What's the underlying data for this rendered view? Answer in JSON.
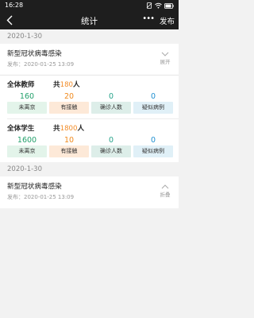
{
  "status": {
    "time": "16:28"
  },
  "nav": {
    "title": "统计",
    "more": "•••",
    "publish": "发布"
  },
  "sections": [
    {
      "date": "2020-1-30",
      "title": "新型冠状病毒感染",
      "meta": "发布：2020-01-25  13:09",
      "toggle_label": "展开",
      "groups": [
        {
          "label": "全体教师",
          "total_prefix": "共",
          "total": "180",
          "total_suffix": "人",
          "stats": [
            {
              "value": "160",
              "label": "未离京"
            },
            {
              "value": "20",
              "label": "有接触"
            },
            {
              "value": "0",
              "label": "确诊人数"
            },
            {
              "value": "0",
              "label": "疑似病例"
            }
          ]
        },
        {
          "label": "全体学生",
          "total_prefix": "共",
          "total": "1800",
          "total_suffix": "人",
          "stats": [
            {
              "value": "1600",
              "label": "未离京"
            },
            {
              "value": "10",
              "label": "有接触"
            },
            {
              "value": "0",
              "label": "确诊人数"
            },
            {
              "value": "0",
              "label": "疑似病例"
            }
          ]
        }
      ]
    },
    {
      "date": "2020-1-30",
      "title": "新型冠状病毒感染",
      "meta": "发布：2020-01-25  13:09",
      "toggle_label": "折叠"
    }
  ]
}
